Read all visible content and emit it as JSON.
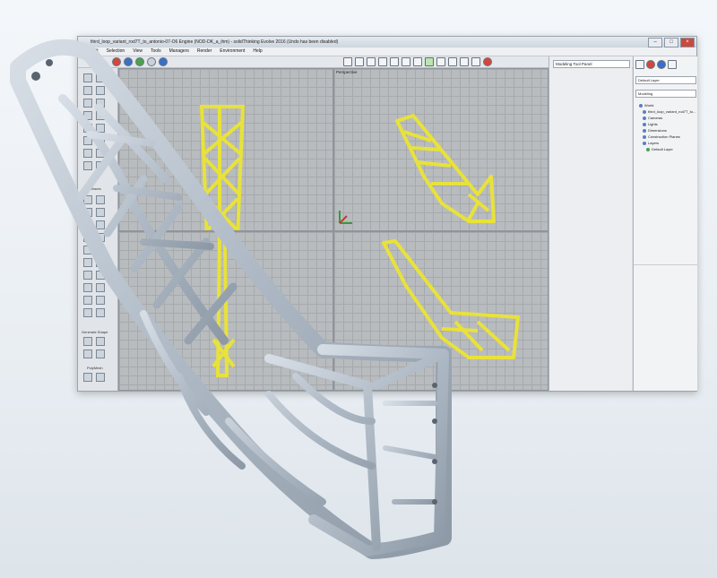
{
  "window": {
    "title": "third_loop_variant_rod7T_to_antonio-07-O6 Engine (NOD-DK_a_ihm) - solidThinking Evolve 2016 (Undo has been disabled)"
  },
  "menu": [
    "Edit",
    "Selection",
    "View",
    "Tools",
    "Managers",
    "Render",
    "Environment",
    "Help"
  ],
  "viewports": {
    "top_right_title": "Perspective"
  },
  "left_panel": {
    "section_surfaces": "Surfaces",
    "section_generate": "Generate Shape",
    "section_polymesh": "PolyMesh"
  },
  "command_panel": {
    "input_text": "Modeling Tool Panel"
  },
  "layers_panel": {
    "current_layer": "Default Layer",
    "display_mode": "Modeling",
    "tree": [
      "World",
      "third_loop_variant_rod7T_to...",
      "Cameras",
      "Lights",
      "Dimensions",
      "Construction Planes",
      "Layers",
      "Default Layer"
    ]
  },
  "colors": {
    "part_yellow": "#e8e23a",
    "part_metal": "#b8c3ce",
    "viewport_bg": "#b9bcbf"
  }
}
